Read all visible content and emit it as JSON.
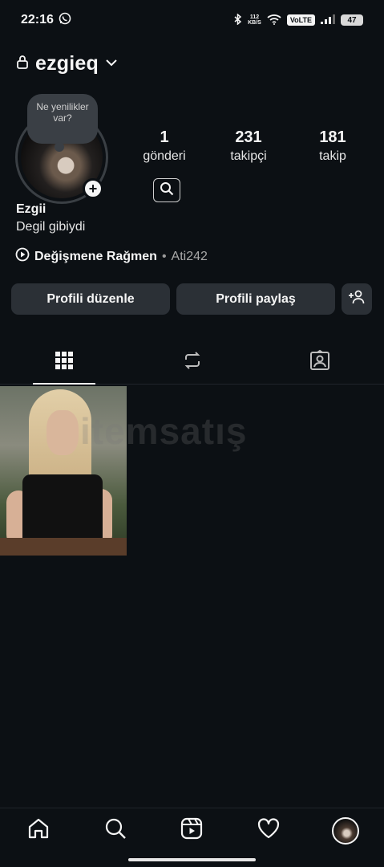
{
  "status_bar": {
    "time": "22:16",
    "net_speed_value": "112",
    "net_speed_unit": "KB/S",
    "volte": "VoLTE",
    "battery": "47"
  },
  "profile": {
    "username": "ezgieq",
    "note": "Ne yenilikler var?",
    "display_name": "Ezgii",
    "bio": "Degil gibiydi",
    "music_title": "Değişmene Rağmen",
    "music_separator": "•",
    "music_artist": "Ati242"
  },
  "stats": [
    {
      "value": "1",
      "label": "gönderi"
    },
    {
      "value": "231",
      "label": "takipçi"
    },
    {
      "value": "181",
      "label": "takip"
    }
  ],
  "actions": {
    "edit_profile": "Profili düzenle",
    "share_profile": "Profili paylaş"
  },
  "tabs": [
    "grid-icon",
    "repost-icon",
    "tagged-icon"
  ],
  "watermark": "itemsatış",
  "bottom_nav": [
    "home-icon",
    "search-icon",
    "reels-icon",
    "heart-icon",
    "profile-avatar"
  ]
}
